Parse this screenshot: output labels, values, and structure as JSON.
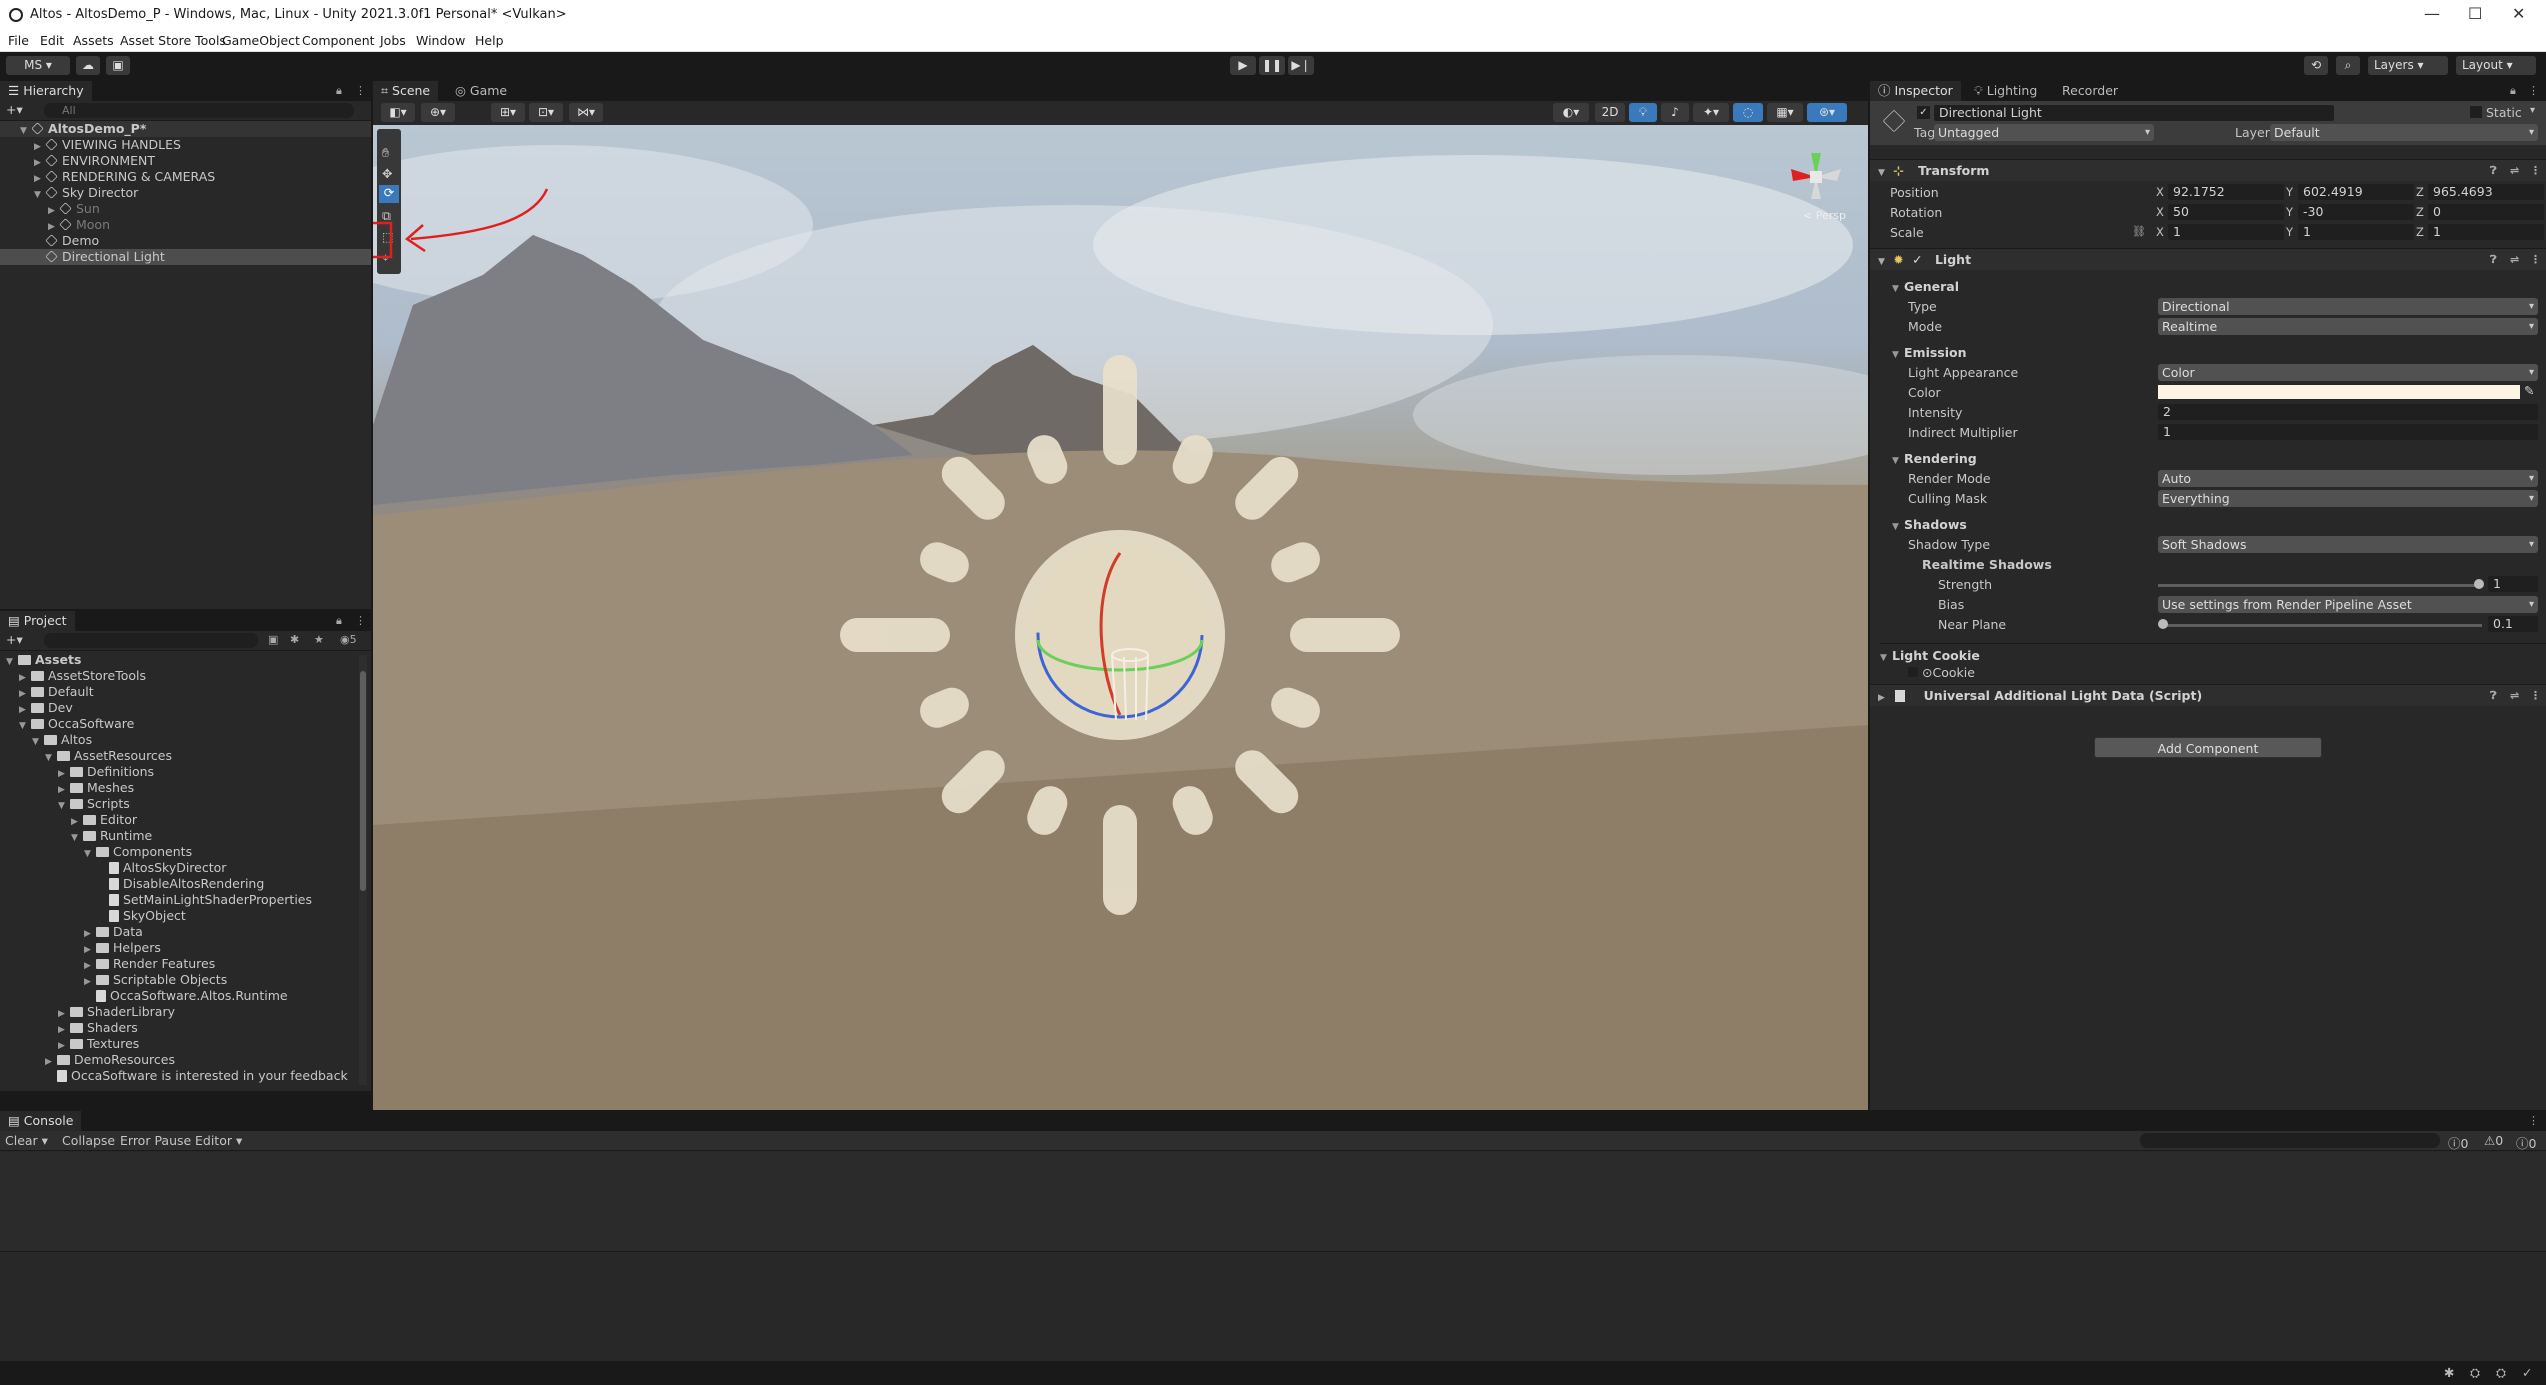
{
  "window": {
    "title": "Altos - AltosDemo_P - Windows, Mac, Linux - Unity 2021.3.0f1 Personal* <Vulkan>",
    "controls": [
      "—",
      "☐",
      "✕"
    ]
  },
  "menu": [
    "File",
    "Edit",
    "Assets",
    "Asset Store Tools",
    "GameObject",
    "Component",
    "Jobs",
    "Window",
    "Help"
  ],
  "toolbar": {
    "account": "MS ▾",
    "layers": "Layers",
    "layout": "Layout"
  },
  "hierarchy": {
    "tab": "Hierarchy",
    "search_placeholder": "All",
    "items": [
      {
        "label": "AltosDemo_P*",
        "indent": 0,
        "type": "scene",
        "exp": "▼"
      },
      {
        "label": "VIEWING HANDLES",
        "indent": 1,
        "type": "go",
        "exp": "▶"
      },
      {
        "label": "ENVIRONMENT",
        "indent": 1,
        "type": "go",
        "exp": "▶"
      },
      {
        "label": "RENDERING & CAMERAS",
        "indent": 1,
        "type": "go",
        "exp": "▶"
      },
      {
        "label": "Sky Director",
        "indent": 1,
        "type": "go",
        "exp": "▼"
      },
      {
        "label": "Sun",
        "indent": 2,
        "type": "go",
        "exp": "▶",
        "dim": true
      },
      {
        "label": "Moon",
        "indent": 2,
        "type": "go",
        "exp": "▶",
        "dim": true
      },
      {
        "label": "Demo",
        "indent": 1,
        "type": "go",
        "exp": ""
      },
      {
        "label": "Directional Light",
        "indent": 1,
        "type": "go",
        "exp": "",
        "selected": true
      }
    ]
  },
  "project": {
    "tab": "Project",
    "count": "5",
    "items": [
      {
        "label": "Assets",
        "indent": 0,
        "exp": "▼",
        "kind": "folder",
        "bold": true
      },
      {
        "label": "AssetStoreTools",
        "indent": 1,
        "exp": "▶",
        "kind": "folder"
      },
      {
        "label": "Default",
        "indent": 1,
        "exp": "▶",
        "kind": "folder"
      },
      {
        "label": "Dev",
        "indent": 1,
        "exp": "▶",
        "kind": "folder"
      },
      {
        "label": "OccaSoftware",
        "indent": 1,
        "exp": "▼",
        "kind": "folder"
      },
      {
        "label": "Altos",
        "indent": 2,
        "exp": "▼",
        "kind": "folder"
      },
      {
        "label": "AssetResources",
        "indent": 3,
        "exp": "▼",
        "kind": "folder"
      },
      {
        "label": "Definitions",
        "indent": 4,
        "exp": "▶",
        "kind": "folder"
      },
      {
        "label": "Meshes",
        "indent": 4,
        "exp": "▶",
        "kind": "folder"
      },
      {
        "label": "Scripts",
        "indent": 4,
        "exp": "▼",
        "kind": "folder"
      },
      {
        "label": "Editor",
        "indent": 5,
        "exp": "▶",
        "kind": "folder"
      },
      {
        "label": "Runtime",
        "indent": 5,
        "exp": "▼",
        "kind": "folder"
      },
      {
        "label": "Components",
        "indent": 6,
        "exp": "▼",
        "kind": "folder"
      },
      {
        "label": "AltosSkyDirector",
        "indent": 7,
        "exp": "",
        "kind": "script"
      },
      {
        "label": "DisableAltosRendering",
        "indent": 7,
        "exp": "",
        "kind": "script"
      },
      {
        "label": "SetMainLightShaderProperties",
        "indent": 7,
        "exp": "",
        "kind": "script"
      },
      {
        "label": "SkyObject",
        "indent": 7,
        "exp": "",
        "kind": "script"
      },
      {
        "label": "Data",
        "indent": 6,
        "exp": "▶",
        "kind": "folder"
      },
      {
        "label": "Helpers",
        "indent": 6,
        "exp": "▶",
        "kind": "folder"
      },
      {
        "label": "Render Features",
        "indent": 6,
        "exp": "▶",
        "kind": "folder"
      },
      {
        "label": "Scriptable Objects",
        "indent": 6,
        "exp": "▶",
        "kind": "folder"
      },
      {
        "label": "OccaSoftware.Altos.Runtime",
        "indent": 6,
        "exp": "",
        "kind": "script"
      },
      {
        "label": "ShaderLibrary",
        "indent": 4,
        "exp": "▶",
        "kind": "folder"
      },
      {
        "label": "Shaders",
        "indent": 4,
        "exp": "▶",
        "kind": "folder"
      },
      {
        "label": "Textures",
        "indent": 4,
        "exp": "▶",
        "kind": "folder"
      },
      {
        "label": "DemoResources",
        "indent": 3,
        "exp": "▶",
        "kind": "folder"
      },
      {
        "label": "OccaSoftware is interested in your feedback",
        "indent": 3,
        "exp": "",
        "kind": "script"
      }
    ]
  },
  "scene": {
    "tabs": [
      "Scene",
      "Game"
    ],
    "mode2d": "2D",
    "persp": "< Persp"
  },
  "inspector": {
    "tabs": [
      "Inspector",
      "Lighting",
      "Recorder"
    ],
    "object_name": "Directional Light",
    "static": "Static",
    "tag_label": "Tag",
    "tag": "Untagged",
    "layer_label": "Layer",
    "layer": "Default",
    "transform": {
      "title": "Transform",
      "position": {
        "label": "Position",
        "x": "92.1752",
        "y": "602.4919",
        "z": "965.4693"
      },
      "rotation": {
        "label": "Rotation",
        "x": "50",
        "y": "-30",
        "z": "0"
      },
      "scale": {
        "label": "Scale",
        "x": "1",
        "y": "1",
        "z": "1"
      }
    },
    "light": {
      "title": "Light",
      "general": "General",
      "type_label": "Type",
      "type": "Directional",
      "mode_label": "Mode",
      "mode": "Realtime",
      "emission": "Emission",
      "appearance_label": "Light Appearance",
      "appearance": "Color",
      "color_label": "Color",
      "color_value": "#fdf4e3",
      "intensity_label": "Intensity",
      "intensity": "2",
      "indirect_label": "Indirect Multiplier",
      "indirect": "1",
      "rendering": "Rendering",
      "render_mode_label": "Render Mode",
      "render_mode": "Auto",
      "culling_label": "Culling Mask",
      "culling": "Everything",
      "shadows": "Shadows",
      "shadow_type_label": "Shadow Type",
      "shadow_type": "Soft Shadows",
      "realtime": "Realtime Shadows",
      "strength_label": "Strength",
      "strength": "1",
      "bias_label": "Bias",
      "bias": "Use settings from Render Pipeline Asset",
      "near_label": "Near Plane",
      "near": "0.1",
      "cookie_head": "Light Cookie",
      "cookie_label": "Cookie"
    },
    "urp": "Universal Additional Light Data (Script)",
    "add_component": "Add Component"
  },
  "console": {
    "tab": "Console",
    "buttons": [
      "Clear",
      "Collapse",
      "Error Pause",
      "Editor"
    ],
    "counts": [
      "0",
      "0",
      "0"
    ]
  },
  "colors": {
    "accent": "#3a79bb",
    "annotation": "#e0201c"
  }
}
